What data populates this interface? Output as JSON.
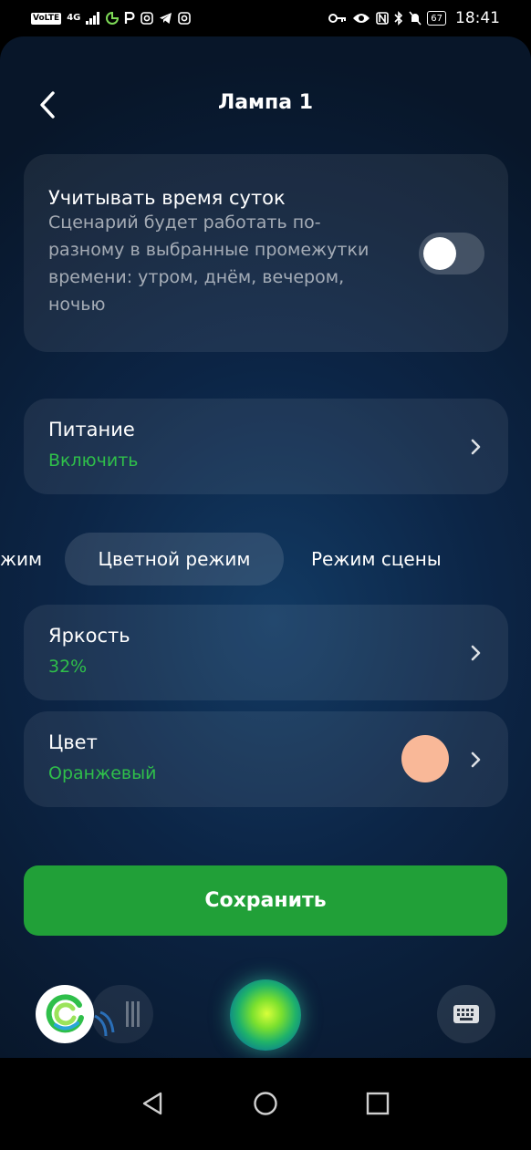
{
  "status_bar": {
    "volte": "VoLTE",
    "network": "4G",
    "battery": "67",
    "time": "18:41"
  },
  "header": {
    "title": "Лампа 1",
    "back_icon": "chevron-left-icon"
  },
  "daytime_card": {
    "title": "Учитывать время суток",
    "description": "Сценарий будет работать по-разному в выбранные промежутки времени: утром, днём, вечером, ночью",
    "toggle_on": false
  },
  "power_card": {
    "title": "Питание",
    "value": "Включить"
  },
  "tabs": [
    {
      "label": "жим",
      "active": false
    },
    {
      "label": "Цветной режим",
      "active": true
    },
    {
      "label": "Режим сцены",
      "active": false
    }
  ],
  "brightness_card": {
    "title": "Яркость",
    "value": "32%"
  },
  "color_card": {
    "title": "Цвет",
    "value": "Оранжевый",
    "swatch": "#f9b898"
  },
  "save_button": {
    "label": "Сохранить"
  },
  "colors": {
    "accent_green": "#21a038",
    "value_green": "#2fbf4a"
  },
  "assistant_bar": {
    "left_icon": "sber-logo-icon",
    "center_icon": "assistant-orb-icon",
    "right_icon": "keyboard-icon"
  },
  "nav_bar": {
    "back": "triangle-back-icon",
    "home": "circle-home-icon",
    "recents": "square-recents-icon"
  }
}
